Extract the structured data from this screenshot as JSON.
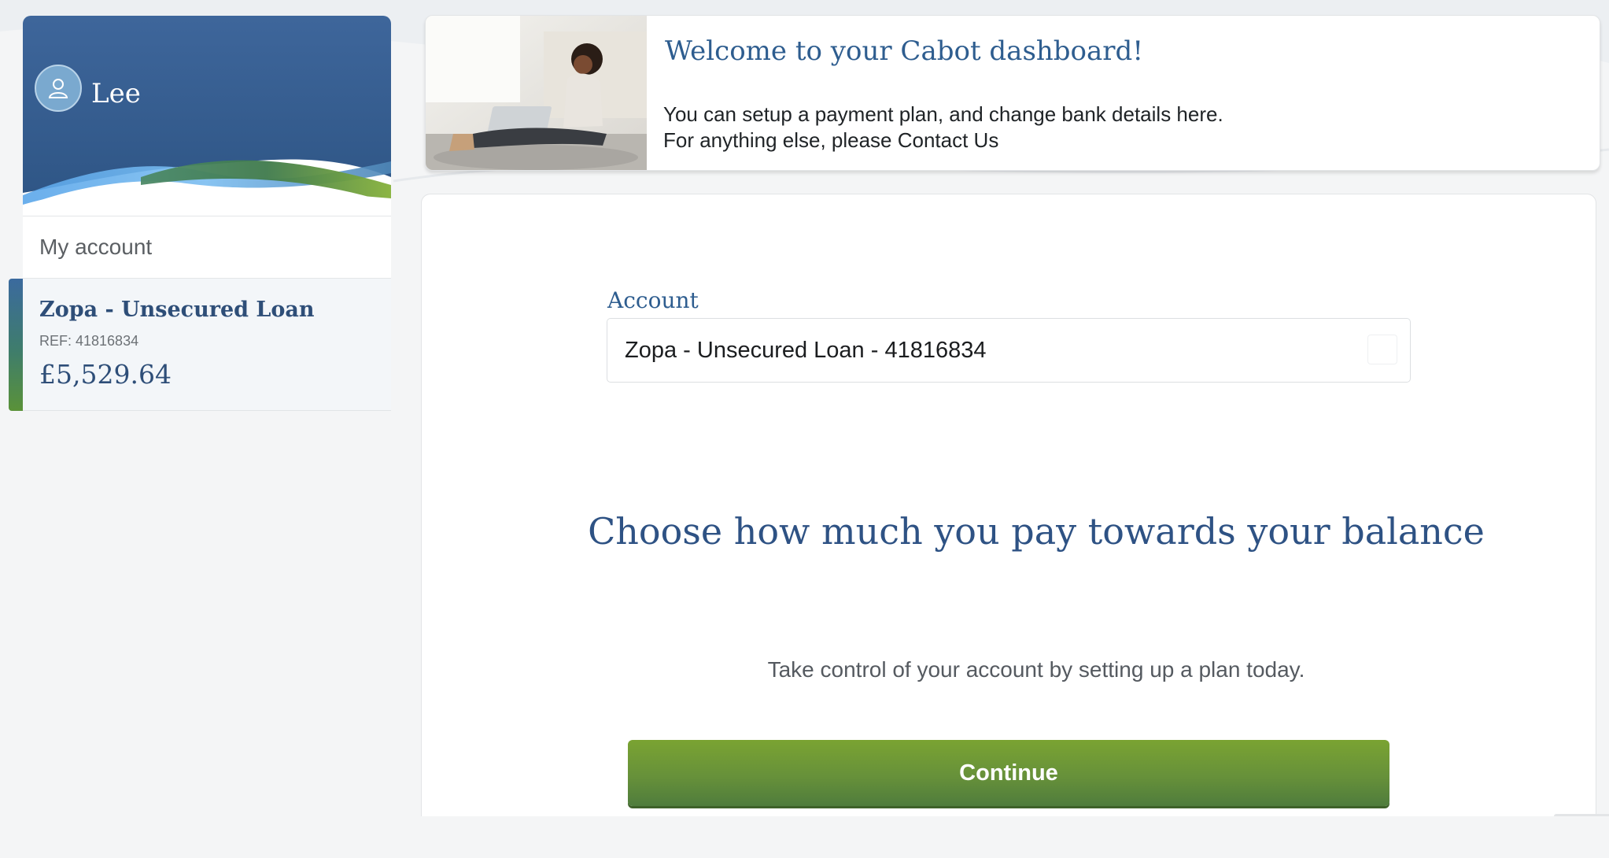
{
  "sidebar": {
    "user_name": "Lee",
    "my_account_label": "My account",
    "account": {
      "title": "Zopa - Unsecured Loan",
      "ref": "REF: 41816834",
      "balance": "£5,529.64"
    }
  },
  "banner": {
    "title": "Welcome to your Cabot dashboard!",
    "line1": "You can setup a payment plan, and change bank details here.",
    "line2": "For anything else, please Contact Us"
  },
  "main": {
    "account_label": "Account",
    "account_selected": "Zopa - Unsecured Loan - 41816834",
    "heading": "Choose how much you pay towards your balance",
    "subtext": "Take control of your account by setting up a plan today.",
    "continue_label": "Continue"
  },
  "colors": {
    "brand_blue": "#3b6599",
    "heading_blue": "#2e5284",
    "button_green": "#67913a",
    "wave_light_blue": "#6fb0ea",
    "wave_green": "#7aa23a"
  },
  "icons": {
    "avatar": "user-icon",
    "select": "select-box-icon"
  }
}
